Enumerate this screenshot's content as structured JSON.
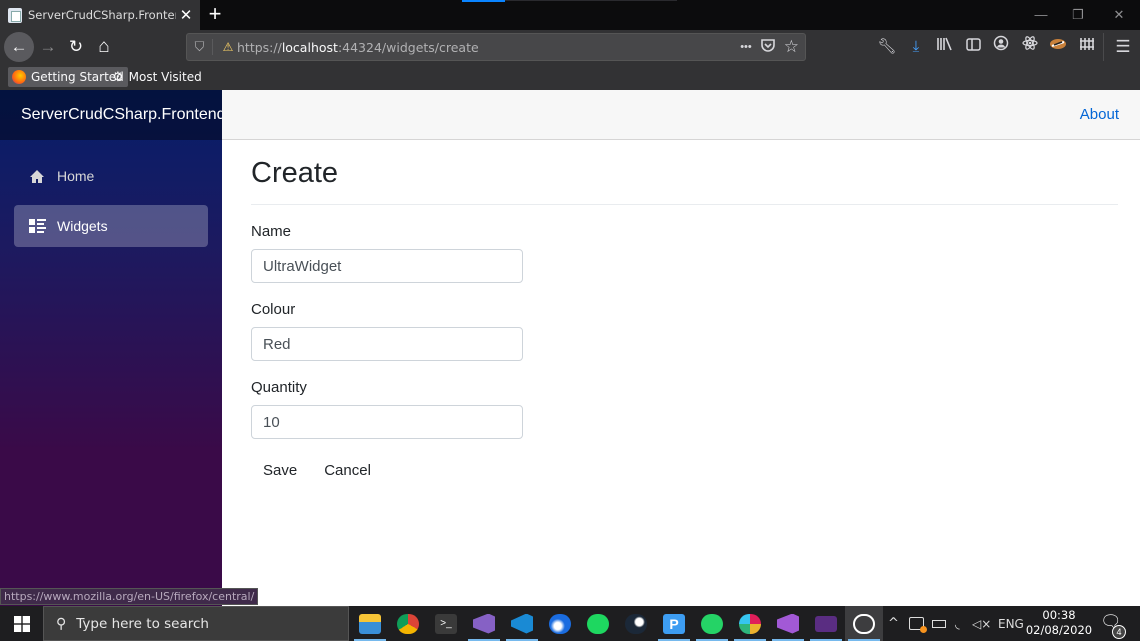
{
  "browser": {
    "tab": {
      "title": "ServerCrudCSharp.Frontend",
      "favicon": "page-icon"
    },
    "new_tab_label": "+",
    "window_controls": {
      "minimize": "—",
      "restore": "❐",
      "close": "✕"
    },
    "nav": {
      "back": "←",
      "forward": "→",
      "reload": "↻",
      "home": "⌂"
    },
    "url": {
      "scheme": "https://",
      "host": "localhost",
      "rest": ":44324/widgets/create"
    },
    "url_actions": {
      "more": "•••",
      "pocket": "pocket-icon",
      "bookmark_star": "☆"
    },
    "toolbar_icons": [
      "wrench-icon",
      "download-icon",
      "library-icon",
      "sidebar-icon",
      "account-icon",
      "react-devtools-icon",
      "extension-icon",
      "containers-icon",
      "menu-icon"
    ],
    "bookmarks": [
      {
        "label": "Getting Started",
        "icon": "firefox-icon"
      },
      {
        "label": "Most Visited",
        "icon": "gear-icon"
      }
    ],
    "status_url": "https://www.mozilla.org/en-US/firefox/central/"
  },
  "app": {
    "brand": "ServerCrudCSharp.Frontend",
    "sidebar": {
      "items": [
        {
          "label": "Home",
          "icon": "home-icon",
          "active": false
        },
        {
          "label": "Widgets",
          "icon": "list-icon",
          "active": true
        }
      ]
    },
    "topbar": {
      "about_label": "About"
    },
    "page_title": "Create",
    "form": {
      "fields": [
        {
          "label": "Name",
          "value": "UltraWidget"
        },
        {
          "label": "Colour",
          "value": "Red"
        },
        {
          "label": "Quantity",
          "value": "10"
        }
      ],
      "save_label": "Save",
      "cancel_label": "Cancel"
    },
    "colors": {
      "link": "#0366d6",
      "sidebar_top": "#051e6a",
      "sidebar_bottom": "#3a0a48"
    }
  },
  "taskbar": {
    "search_placeholder": "Type here to search",
    "apps": [
      "file-explorer",
      "chrome",
      "terminal",
      "visual-studio",
      "vscode",
      "firefox-dev",
      "spotify",
      "steam",
      "pixiv",
      "whatsapp",
      "slack",
      "visual-studio-preview",
      "powershell",
      "mountain-app"
    ],
    "tray": {
      "chevron": "^",
      "language": "ENG",
      "volume": "🔇"
    },
    "time": "00:38",
    "date": "02/08/2020",
    "notification_count": "4"
  }
}
